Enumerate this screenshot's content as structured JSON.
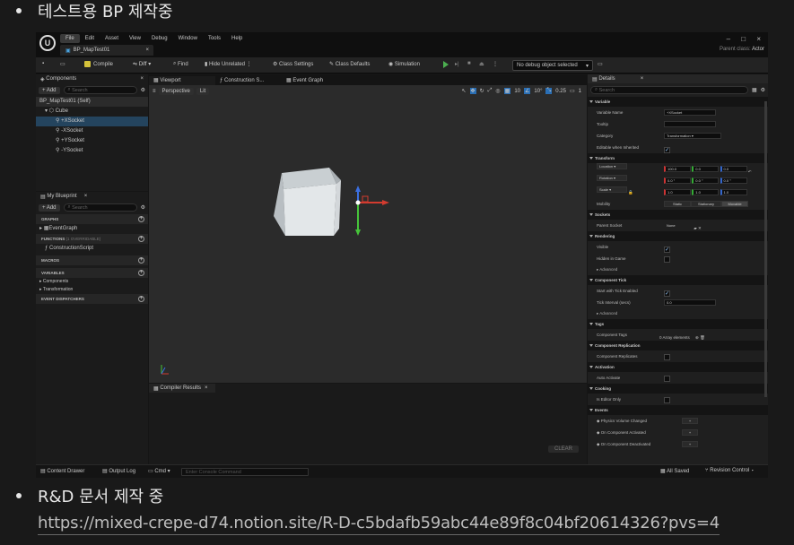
{
  "doc": {
    "bullet1": "테스트용 BP 제작중",
    "bullet2": "R&D 문서 제작 중",
    "link": "https://mixed-crepe-d74.notion.site/R-D-c5bdafb59abc44e89f8c04bf20614326?pvs=4"
  },
  "menu": [
    "File",
    "Edit",
    "Asset",
    "View",
    "Debug",
    "Window",
    "Tools",
    "Help"
  ],
  "doc_tab": "BP_MapTest01",
  "parent_class_label": "Parent class:",
  "parent_class_value": "Actor",
  "toolbar": {
    "compile": "Compile",
    "diff": "Diff",
    "find": "Find",
    "hide_unrelated": "Hide Unrelated",
    "class_settings": "Class Settings",
    "class_defaults": "Class Defaults",
    "simulation": "Simulation",
    "debug_dropdown": "No debug object selected"
  },
  "components": {
    "title": "Components",
    "add": "+ Add",
    "search": "Search",
    "tree": [
      "BP_MapTest01 (Self)",
      "Cube",
      "+XSocket",
      "-XSocket",
      "+YSocket",
      "-YSocket"
    ]
  },
  "my_blueprint": {
    "title": "My Blueprint",
    "add": "+ Add",
    "search": "Search",
    "graphs": "GRAPHS",
    "event_graph": "EventGraph",
    "functions": "FUNCTIONS",
    "functions_count": "(1 OVERRIDABLE)",
    "construction_script": "ConstructionScript",
    "macros": "MACROS",
    "variables": "VARIABLES",
    "var_components": "Components",
    "var_transformation": "Transformation",
    "event_dispatchers": "EVENT DISPATCHERS"
  },
  "center_tabs": [
    "Viewport",
    "Construction S...",
    "Event Graph"
  ],
  "viewport": {
    "perspective": "Perspective",
    "lit": "Lit",
    "grid_snap": "10",
    "rot_snap": "10°",
    "scale_snap": "0.25",
    "cam_speed": "1"
  },
  "compiler": {
    "title": "Compiler Results",
    "clear": "CLEAR"
  },
  "details": {
    "title": "Details",
    "search": "Search",
    "sections": {
      "variable": "Variable",
      "transform": "Transform",
      "sockets": "Sockets",
      "rendering": "Rendering",
      "component_tick": "Component Tick",
      "tags": "Tags",
      "component_replication": "Component Replication",
      "activation": "Activation",
      "cooking": "Cooking",
      "events": "Events"
    },
    "variable_name_label": "Variable Name",
    "variable_name": "+XSocket",
    "tooltip_label": "Tooltip",
    "category_label": "Category",
    "category": "Transformation",
    "editable_label": "Editable when Inherited",
    "location_label": "Location",
    "location": [
      "100.0",
      "0.0",
      "0.0"
    ],
    "rotation_label": "Rotation",
    "rotation": [
      "0.0 °",
      "0.0 °",
      "0.0 °"
    ],
    "scale_label": "Scale",
    "scale": [
      "1.0",
      "1.0",
      "1.0"
    ],
    "mobility_label": "Mobility",
    "mobility": [
      "Static",
      "Stationary",
      "Movable"
    ],
    "parent_socket_label": "Parent Socket",
    "parent_socket": "None",
    "visible_label": "Visible",
    "hidden_label": "Hidden in Game",
    "advanced": "Advanced",
    "start_tick_label": "Start with Tick Enabled",
    "tick_interval_label": "Tick Interval (secs)",
    "tick_interval": "0.0",
    "component_tags_label": "Component Tags",
    "component_tags": "0 Array elements",
    "replicates_label": "Component Replicates",
    "auto_activate_label": "Auto Activate",
    "editor_only_label": "Is Editor Only",
    "ev1": "Physics Volume Changed",
    "ev2": "On Component Activated",
    "ev3": "On Component Deactivated"
  },
  "status": {
    "content_drawer": "Content Drawer",
    "output_log": "Output Log",
    "cmd": "Cmd",
    "console_placeholder": "Enter Console Command",
    "all_saved": "All Saved",
    "revision": "Revision Control"
  }
}
